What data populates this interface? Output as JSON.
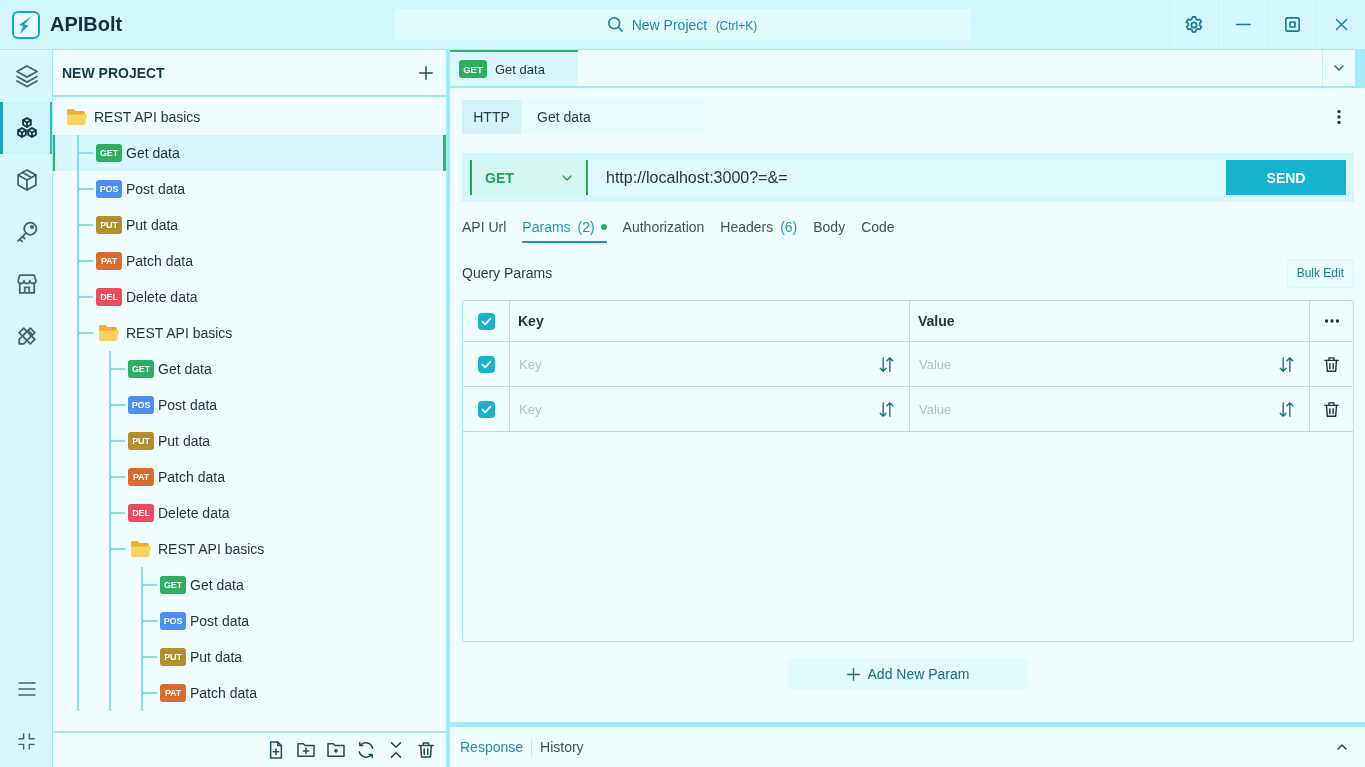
{
  "app": {
    "name": "APIBolt"
  },
  "search": {
    "label": "New Project",
    "shortcut": "(Ctrl+K)"
  },
  "activity_bar": [
    {
      "selected": false
    },
    {
      "selected": true
    },
    {
      "selected": false
    },
    {
      "selected": false
    },
    {
      "selected": false
    },
    {
      "selected": false
    }
  ],
  "sidebar": {
    "title": "NEW PROJECT",
    "tree": [
      {
        "kind": "folder",
        "label": "REST API basics",
        "expanded": true,
        "selected": false,
        "children": [
          {
            "kind": "request",
            "method": "GET",
            "color": "#2eae62",
            "label": "Get data",
            "selected": true
          },
          {
            "kind": "request",
            "method": "POS",
            "color": "#4d8ef5",
            "label": "Post data",
            "selected": false
          },
          {
            "kind": "request",
            "method": "PUT",
            "color": "#b38f2d",
            "label": "Put data",
            "selected": false
          },
          {
            "kind": "request",
            "method": "PAT",
            "color": "#dc6a2c",
            "label": "Patch data",
            "selected": false
          },
          {
            "kind": "request",
            "method": "DEL",
            "color": "#ef4b5b",
            "label": "Delete data",
            "selected": false
          },
          {
            "kind": "folder",
            "label": "REST API basics",
            "expanded": true,
            "selected": false,
            "children": [
              {
                "kind": "request",
                "method": "GET",
                "color": "#2eae62",
                "label": "Get data",
                "selected": false
              },
              {
                "kind": "request",
                "method": "POS",
                "color": "#4d8ef5",
                "label": "Post data",
                "selected": false
              },
              {
                "kind": "request",
                "method": "PUT",
                "color": "#b38f2d",
                "label": "Put data",
                "selected": false
              },
              {
                "kind": "request",
                "method": "PAT",
                "color": "#dc6a2c",
                "label": "Patch data",
                "selected": false
              },
              {
                "kind": "request",
                "method": "DEL",
                "color": "#ef4b5b",
                "label": "Delete data",
                "selected": false
              },
              {
                "kind": "folder",
                "label": "REST API basics",
                "expanded": true,
                "selected": false,
                "children": [
                  {
                    "kind": "request",
                    "method": "GET",
                    "color": "#2eae62",
                    "label": "Get data",
                    "selected": false
                  },
                  {
                    "kind": "request",
                    "method": "POS",
                    "color": "#4d8ef5",
                    "label": "Post data",
                    "selected": false
                  },
                  {
                    "kind": "request",
                    "method": "PUT",
                    "color": "#b38f2d",
                    "label": "Put data",
                    "selected": false
                  },
                  {
                    "kind": "request",
                    "method": "PAT",
                    "color": "#dc6a2c",
                    "label": "Patch data",
                    "selected": false
                  }
                ]
              }
            ]
          }
        ]
      }
    ]
  },
  "tabs": [
    {
      "method": "GET",
      "color": "#2eae62",
      "label": "Get data",
      "selected": true
    }
  ],
  "request": {
    "protocol": "HTTP",
    "name": "Get data",
    "method": "GET",
    "url": "http://localhost:3000?=&=",
    "send": "SEND"
  },
  "request_tabs": [
    {
      "label": "API Url",
      "selected": false,
      "modified": false
    },
    {
      "label": "Params",
      "count": "(2)",
      "selected": true,
      "modified": true
    },
    {
      "label": "Authorization",
      "selected": false,
      "modified": false
    },
    {
      "label": "Headers",
      "count": "(6)",
      "selected": false,
      "modified": false
    },
    {
      "label": "Body",
      "selected": false,
      "modified": false
    },
    {
      "label": "Code",
      "selected": false,
      "modified": false
    }
  ],
  "query_params": {
    "title": "Query Params",
    "bulk_edit": "Bulk Edit",
    "select_all": {
      "checked": true
    },
    "columns": [
      {
        "label": "Key"
      },
      {
        "label": "Value"
      }
    ],
    "rows": [
      {
        "checked": true,
        "key": {
          "placeholder": "Key"
        },
        "value": {
          "placeholder": "Value"
        }
      },
      {
        "checked": true,
        "key": {
          "placeholder": "Key"
        },
        "value": {
          "placeholder": "Value"
        }
      }
    ],
    "add_button": "Add New Param"
  },
  "bottom_panel": {
    "tabs": [
      {
        "label": "Response",
        "selected": true
      },
      {
        "label": "History",
        "selected": false
      }
    ]
  }
}
